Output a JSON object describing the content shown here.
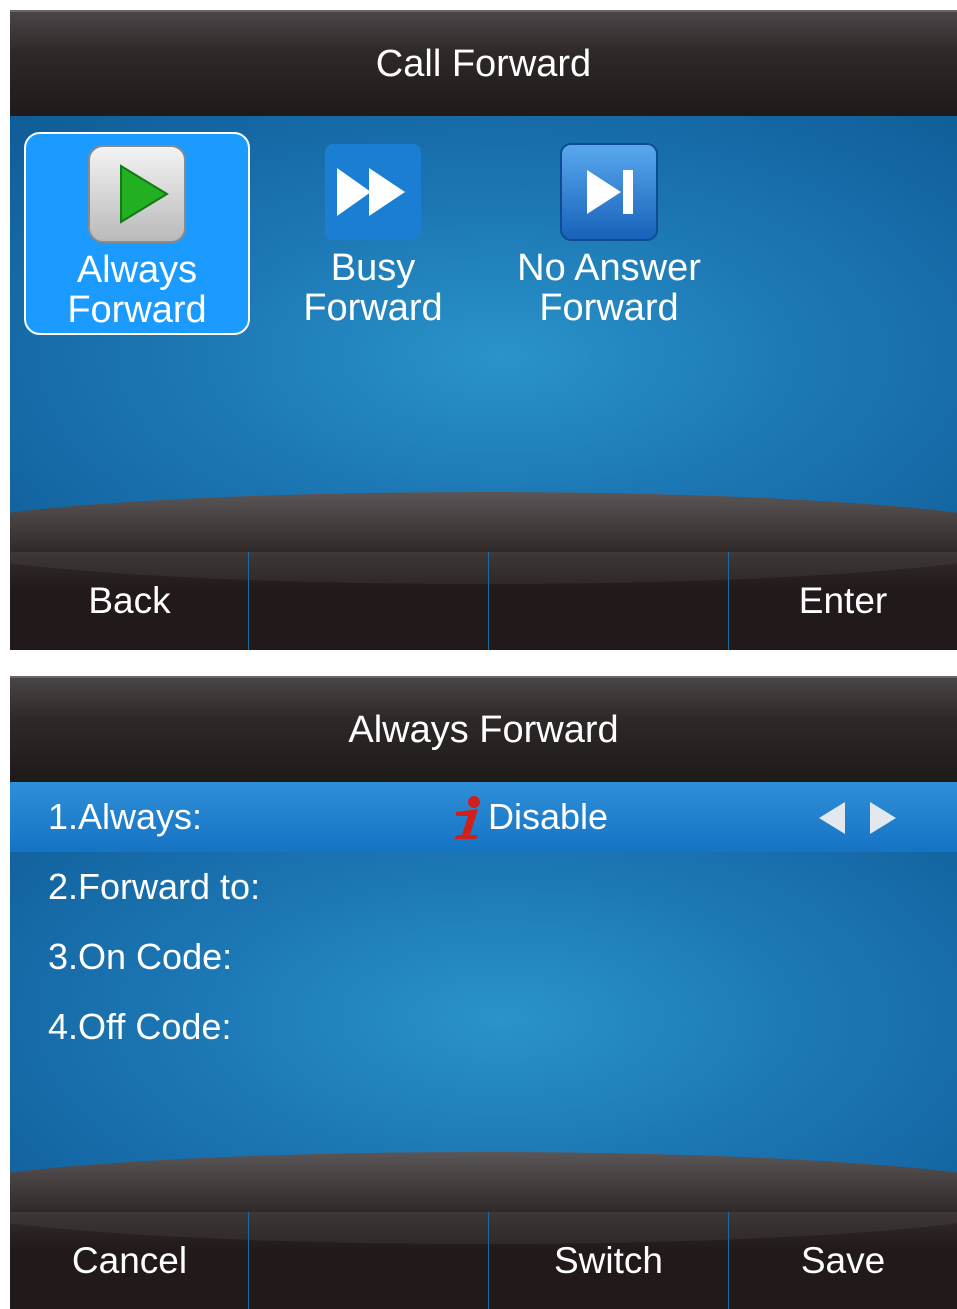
{
  "screen1": {
    "title": "Call Forward",
    "items": [
      {
        "label_line1": "Always",
        "label_line2": "Forward",
        "icon": "play-icon",
        "selected": true
      },
      {
        "label_line1": "Busy",
        "label_line2": "Forward",
        "icon": "fast-forward-icon",
        "selected": false
      },
      {
        "label_line1": "No Answer",
        "label_line2": "Forward",
        "icon": "skip-forward-icon",
        "selected": false
      }
    ],
    "softkeys": [
      "Back",
      "",
      "",
      "Enter"
    ]
  },
  "screen2": {
    "title": "Always Forward",
    "rows": [
      {
        "label": "1.Always:",
        "value": "Disable",
        "selected": true
      },
      {
        "label": "2.Forward to:",
        "value": ""
      },
      {
        "label": "3.On Code:",
        "value": ""
      },
      {
        "label": "4.Off Code:",
        "value": ""
      }
    ],
    "softkeys": [
      "Cancel",
      "",
      "Switch",
      "Save"
    ]
  },
  "colors": {
    "selection": "#1b9bff",
    "accent_green": "#22b022",
    "info_red": "#d0201c"
  }
}
